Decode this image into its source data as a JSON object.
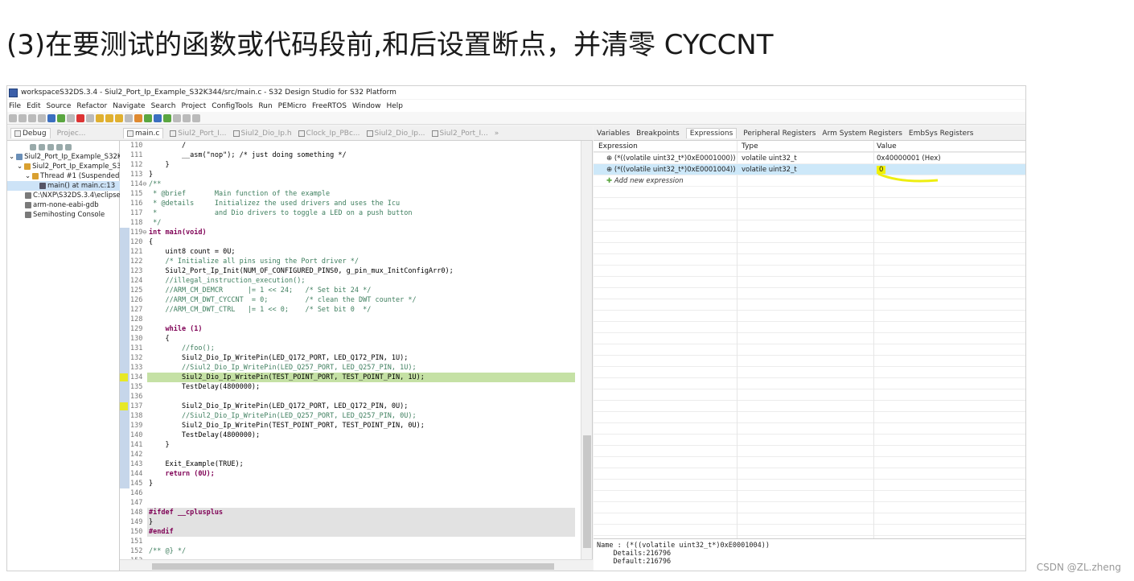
{
  "heading": "(3)在要测试的函数或代码段前,和后设置断点，并清零 CYCCNT",
  "window": {
    "title": "workspaceS32DS.3.4 - Siul2_Port_Ip_Example_S32K344/src/main.c - S32 Design Studio for S32 Platform"
  },
  "menu": [
    "File",
    "Edit",
    "Source",
    "Refactor",
    "Navigate",
    "Search",
    "Project",
    "ConfigTools",
    "Run",
    "PEMicro",
    "FreeRTOS",
    "Window",
    "Help"
  ],
  "debug_view": {
    "tabs": [
      "Debug",
      "Projec..."
    ],
    "tree": [
      "Siul2_Port_Ip_Example_S32K",
      "Siul2_Port_Ip_Example_S3",
      "Thread #1 (Suspended",
      "main() at main.c:13",
      "C:\\NXP\\S32DS.3.4\\eclipse",
      "arm-none-eabi-gdb",
      "Semihosting Console"
    ]
  },
  "editor": {
    "tabs": [
      "main.c",
      "Siul2_Port_I...",
      "Siul2_Dio_Ip.h",
      "Clock_Ip_PBc...",
      "Siul2_Dio_Ip...",
      "Siul2_Port_I...",
      "»"
    ],
    "lines": [
      {
        "n": "110",
        "t": "        /"
      },
      {
        "n": "111",
        "t": "        __asm(\"nop\"); /* just doing something */"
      },
      {
        "n": "112",
        "t": "    }"
      },
      {
        "n": "113",
        "t": "}"
      },
      {
        "n": "114⊖",
        "t": "/**"
      },
      {
        "n": "115",
        "t": " * @brief       Main function of the example"
      },
      {
        "n": "116",
        "t": " * @details     Initializez the used drivers and uses the Icu"
      },
      {
        "n": "117",
        "t": " *              and Dio drivers to toggle a LED on a push button"
      },
      {
        "n": "118",
        "t": " */"
      },
      {
        "n": "119⊖",
        "t": "int main(void)"
      },
      {
        "n": "120",
        "t": "{"
      },
      {
        "n": "121",
        "t": "    uint8 count = 0U;"
      },
      {
        "n": "122",
        "t": "    /* Initialize all pins using the Port driver */"
      },
      {
        "n": "123",
        "t": "    Siul2_Port_Ip_Init(NUM_OF_CONFIGURED_PINS0, g_pin_mux_InitConfigArr0);"
      },
      {
        "n": "124",
        "t": "    //illegal_instruction_execution();"
      },
      {
        "n": "125",
        "t": "    //ARM_CM_DEMCR      |= 1 << 24;   /* Set bit 24 */"
      },
      {
        "n": "126",
        "t": "    //ARM_CM_DWT_CYCCNT  = 0;         /* clean the DWT counter */"
      },
      {
        "n": "127",
        "t": "    //ARM_CM_DWT_CTRL   |= 1 << 0;    /* Set bit 0  */"
      },
      {
        "n": "128",
        "t": ""
      },
      {
        "n": "129",
        "t": "    while (1)"
      },
      {
        "n": "130",
        "t": "    {"
      },
      {
        "n": "131",
        "t": "        //foo();"
      },
      {
        "n": "132",
        "t": "        Siul2_Dio_Ip_WritePin(LED_Q172_PORT, LED_Q172_PIN, 1U);"
      },
      {
        "n": "133",
        "t": "        //Siul2_Dio_Ip_WritePin(LED_Q257_PORT, LED_Q257_PIN, 1U);"
      },
      {
        "n": "134",
        "t": "        Siul2_Dio_Ip_WritePin(TEST_POINT_PORT, TEST_POINT_PIN, 1U);"
      },
      {
        "n": "135",
        "t": "        TestDelay(4800000);"
      },
      {
        "n": "136",
        "t": ""
      },
      {
        "n": "137",
        "t": "        Siul2_Dio_Ip_WritePin(LED_Q172_PORT, LED_Q172_PIN, 0U);"
      },
      {
        "n": "138",
        "t": "        //Siul2_Dio_Ip_WritePin(LED_Q257_PORT, LED_Q257_PIN, 0U);"
      },
      {
        "n": "139",
        "t": "        Siul2_Dio_Ip_WritePin(TEST_POINT_PORT, TEST_POINT_PIN, 0U);"
      },
      {
        "n": "140",
        "t": "        TestDelay(4800000);"
      },
      {
        "n": "141",
        "t": "    }"
      },
      {
        "n": "142",
        "t": ""
      },
      {
        "n": "143",
        "t": "    Exit_Example(TRUE);"
      },
      {
        "n": "144",
        "t": "    return (0U);"
      },
      {
        "n": "145",
        "t": "}"
      },
      {
        "n": "146",
        "t": ""
      },
      {
        "n": "147",
        "t": ""
      },
      {
        "n": "148",
        "t": "#ifdef __cplusplus"
      },
      {
        "n": "149",
        "t": "}"
      },
      {
        "n": "150",
        "t": "#endif"
      },
      {
        "n": "151",
        "t": ""
      },
      {
        "n": "152",
        "t": "/** @} */"
      },
      {
        "n": "153",
        "t": ""
      }
    ]
  },
  "expressions_view": {
    "tabs": [
      "Variables",
      "Breakpoints",
      "Expressions",
      "Peripheral Registers",
      "Arm System Registers",
      "EmbSys Registers"
    ],
    "columns": [
      "Expression",
      "Type",
      "Value"
    ],
    "rows": [
      {
        "expression": "(*((volatile uint32_t*)0xE0001000))",
        "type": "volatile uint32_t",
        "value": "0x40000001 (Hex)"
      },
      {
        "expression": "(*((volatile uint32_t*)0xE0001004))",
        "type": "volatile uint32_t",
        "value": "0"
      }
    ],
    "add_new": "Add new expression",
    "details": "Name : (*((volatile uint32_t*)0xE0001004))\n    Details:216796\n    Default:216796"
  },
  "watermark": "CSDN @ZL.zheng",
  "colors": {
    "highlight": "#f2f200",
    "current_line": "#c5e1a5"
  }
}
